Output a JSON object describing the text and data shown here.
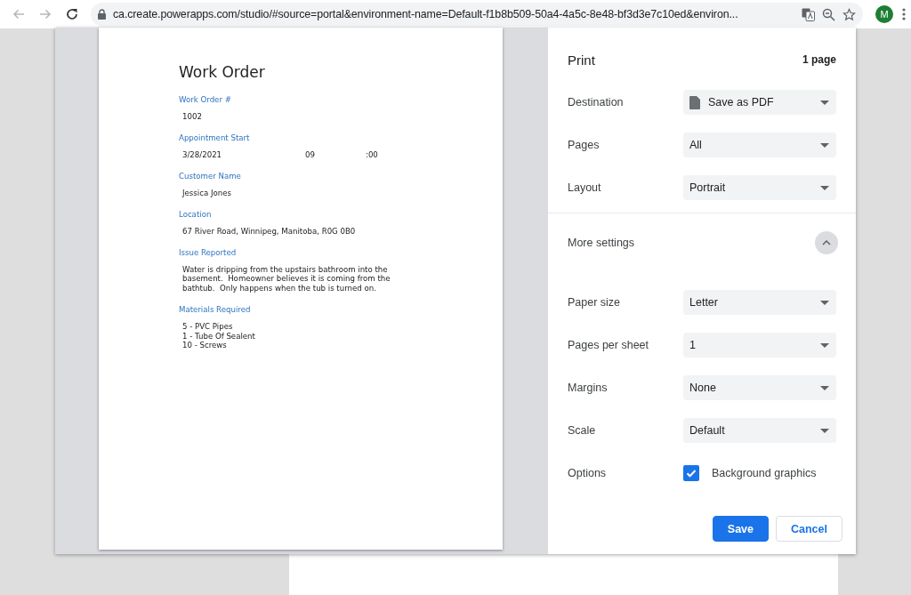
{
  "browser": {
    "back_disabled": true,
    "forward_disabled": true,
    "url": "ca.create.powerapps.com/studio/#source=portal&environment-name=Default-f1b8b509-50a4-4a5c-8e48-bf3d3e7c10ed&environ...",
    "avatar": "M"
  },
  "preview": {
    "title": "Work Order",
    "fields": [
      {
        "label": "Work Order #",
        "kind": "stack",
        "values": [
          "1002"
        ]
      },
      {
        "label": "Appointment Start",
        "kind": "row",
        "values": [
          "3/28/2021",
          "09",
          ":00"
        ]
      },
      {
        "label": "Customer Name",
        "kind": "stack",
        "values": [
          "Jessica Jones"
        ]
      },
      {
        "label": "Location",
        "kind": "stack",
        "values": [
          "67 River Road, Winnipeg, Manitoba, R0G 0B0"
        ]
      },
      {
        "label": "Issue Reported",
        "kind": "paragraph",
        "values": [
          "Water is dripping from the upstairs bathroom into the basement.  Homeowner believes it is coming from the bathtub.  Only happens when the tub is turned on."
        ]
      },
      {
        "label": "Materials Required",
        "kind": "lines",
        "values": [
          "5 - PVC Pipes",
          "1 - Tube Of Sealent",
          "10 - Screws"
        ]
      }
    ]
  },
  "print": {
    "title": "Print",
    "page_count": "1 page",
    "settings": [
      {
        "label": "Destination",
        "kind": "document-select",
        "value": "Save as PDF"
      },
      {
        "label": "Pages",
        "kind": "select",
        "value": "All"
      },
      {
        "label": "Layout",
        "kind": "select",
        "value": "Portrait"
      }
    ],
    "more_settings": {
      "label": "More settings",
      "expanded": true
    },
    "more": [
      {
        "label": "Paper size",
        "kind": "select",
        "value": "Letter"
      },
      {
        "label": "Pages per sheet",
        "kind": "select",
        "value": "1"
      },
      {
        "label": "Margins",
        "kind": "select",
        "value": "None"
      },
      {
        "label": "Scale",
        "kind": "select",
        "value": "Default"
      },
      {
        "label": "Options",
        "kind": "checkbox",
        "value": "Background graphics",
        "checked": true
      }
    ],
    "buttons": [
      {
        "label": "Save",
        "kind": "primary"
      },
      {
        "label": "Cancel",
        "kind": "secondary"
      }
    ]
  }
}
